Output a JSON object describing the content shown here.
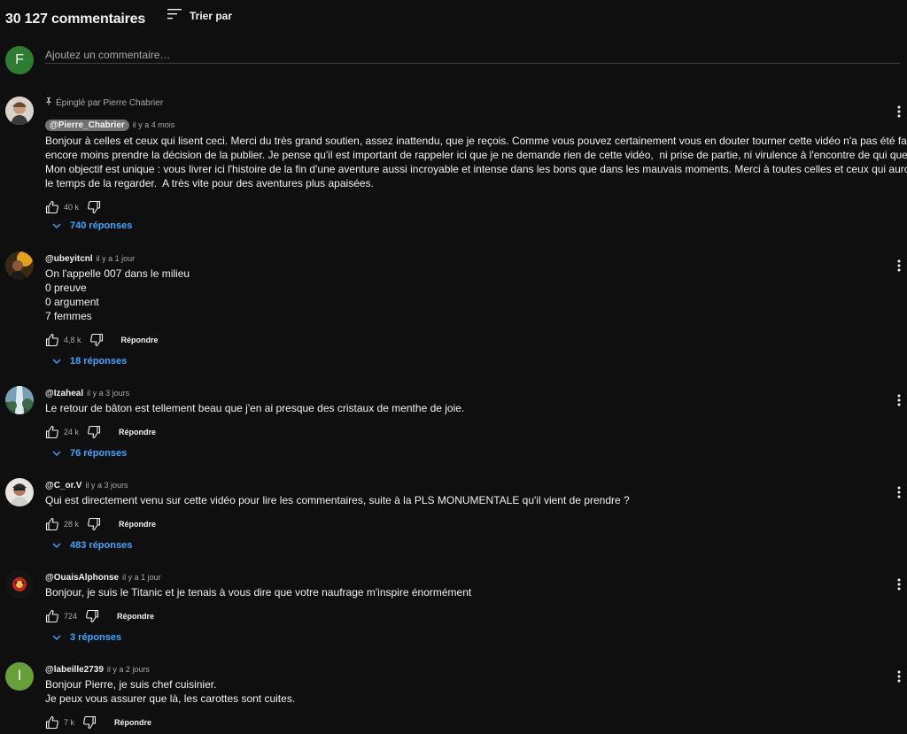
{
  "header": {
    "count": "30 127 commentaires",
    "sort_label": "Trier par"
  },
  "add_comment": {
    "avatar_letter": "F",
    "placeholder": "Ajoutez un commentaire…",
    "avatar_color": "#2e7d32"
  },
  "comments": [
    {
      "pinned_label": "Épinglé par Pierre Chabrier",
      "author": "@Pierre_Chabrier",
      "time": "il y a 4 mois",
      "lines": [
        "Bonjour à celles et ceux qui lisent ceci. Merci du très grand soutien, assez inattendu, que je reçois. Comme vous pouvez certainement vous en douter tourner cette vidéo n'a pas été facile et",
        "encore moins prendre la décision de la publier. Je pense qu'il est important de rappeler ici que je ne demande rien de cette vidéo,  ni prise de partie, ni virulence à l'encontre de qui que ce soit.",
        "Mon objectif est unique : vous livrer ici l'histoire de la fin d'une aventure aussi incroyable et intense dans les bons que dans les mauvais moments. Merci à toutes celles et ceux qui auront pris",
        "le temps de la regarder.  A très vite pour des aventures plus apaisées."
      ],
      "likes": "40 k",
      "replies": "740 réponses"
    },
    {
      "author": "@ubeyitcnl",
      "time": "il y a 1 jour",
      "lines": [
        "On l'appelle 007 dans le milieu",
        "0 preuve",
        "0 argument",
        "7 femmes"
      ],
      "likes": "4,8 k",
      "reply_label": "Répondre",
      "replies": "18 réponses"
    },
    {
      "author": "@Izaheal",
      "time": "il y a 3 jours",
      "lines": [
        "Le retour de bâton est tellement beau que j'en ai presque des cristaux de menthe de joie."
      ],
      "likes": "24 k",
      "reply_label": "Répondre",
      "replies": "76 réponses"
    },
    {
      "author": "@C_or.V",
      "time": "il y a 3 jours",
      "lines": [
        "Qui est directement venu sur cette vidéo pour lire les commentaires, suite à la PLS MONUMENTALE qu'il vient de prendre ?"
      ],
      "likes": "28 k",
      "reply_label": "Répondre",
      "replies": "483 réponses"
    },
    {
      "author": "@OuaisAlphonse",
      "time": "il y a 1 jour",
      "lines": [
        "Bonjour, je suis le Titanic et je tenais à vous dire que votre naufrage m'inspire énormément"
      ],
      "likes": "724",
      "reply_label": "Répondre",
      "replies": "3 réponses"
    },
    {
      "author": "@labeille2739",
      "avatar_letter": "l",
      "avatar_color": "#689f38",
      "time": "il y a 2 jours",
      "lines": [
        "Bonjour Pierre, je suis chef cuisinier.",
        "Je peux vous assurer que là, les carottes sont cuites."
      ],
      "likes": "7 k",
      "reply_label": "Répondre"
    }
  ]
}
